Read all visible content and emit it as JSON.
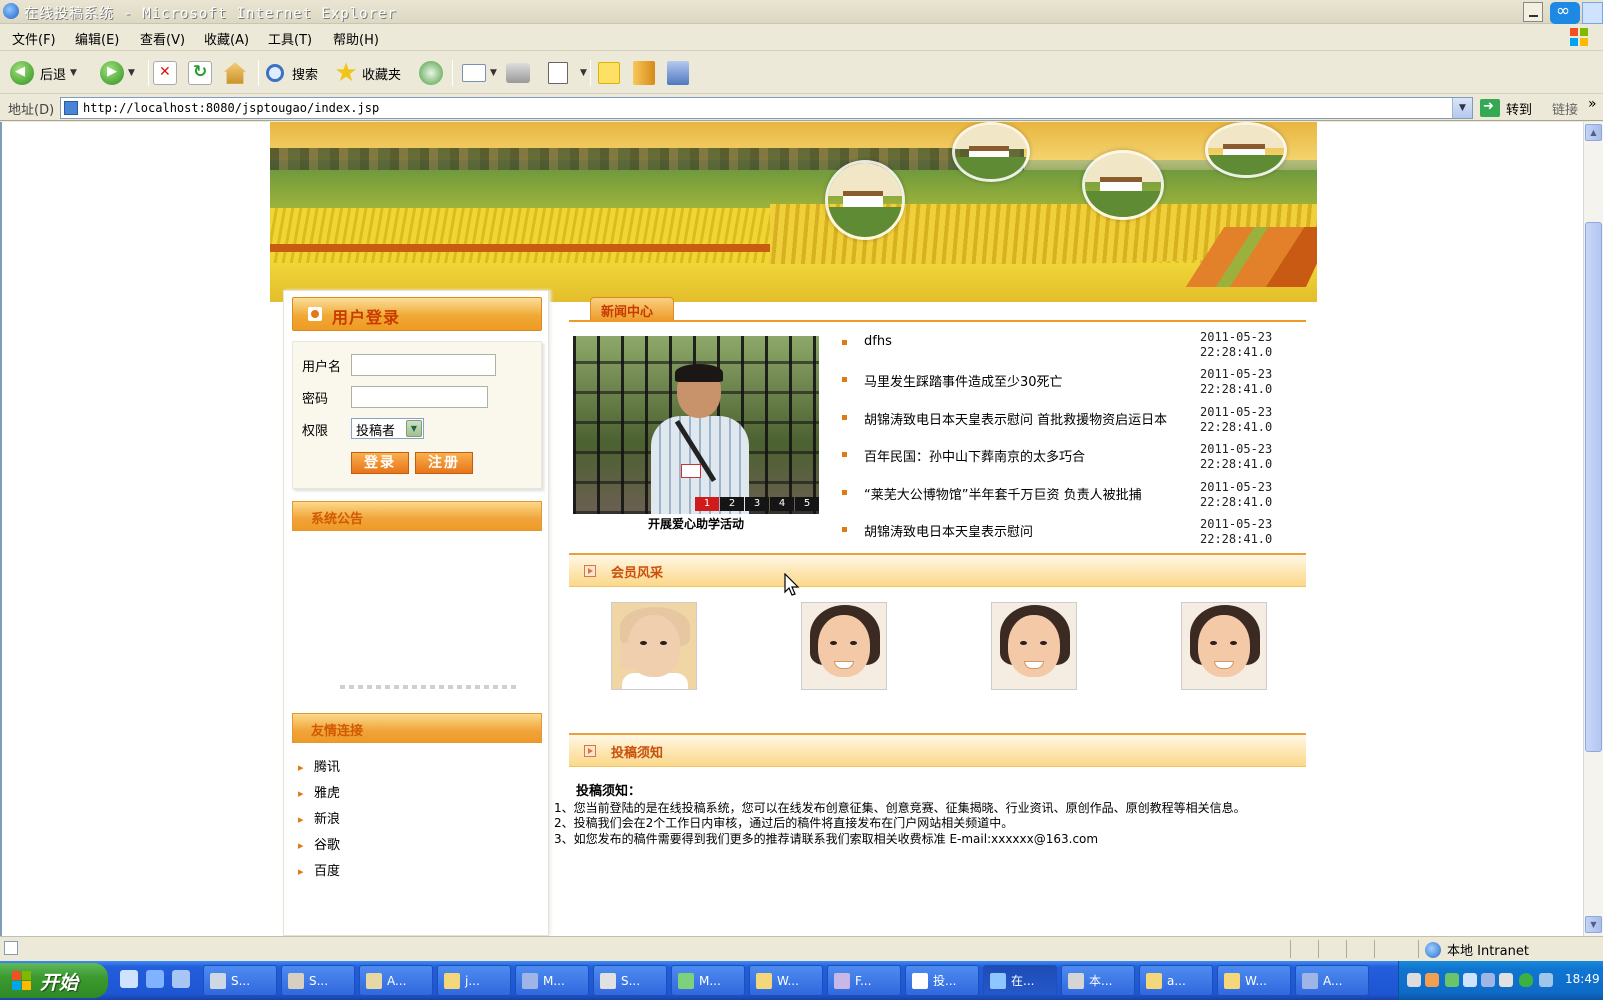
{
  "browser": {
    "title": "在线投稿系统 - Microsoft Internet Explorer",
    "menus": [
      "文件(F)",
      "编辑(E)",
      "查看(V)",
      "收藏(A)",
      "工具(T)",
      "帮助(H)"
    ],
    "toolbar": {
      "back": "后退",
      "search": "搜索",
      "favorites": "收藏夹"
    },
    "address_label": "地址(D)",
    "url": "http://localhost:8080/jsptougao/index.jsp",
    "go": "转到",
    "links": "链接",
    "more": "»",
    "status_zone": "本地 Intranet"
  },
  "login": {
    "title": "用户登录",
    "username_label": "用户名",
    "username_value": "",
    "password_label": "密码",
    "password_value": "",
    "role_label": "权限",
    "role_selected": "投稿者",
    "login_button": "登录",
    "register_button": "注册"
  },
  "announcement": {
    "title": "系统公告"
  },
  "friend_links": {
    "title": "友情连接",
    "items": [
      "腾讯",
      "雅虎",
      "新浪",
      "谷歌",
      "百度"
    ]
  },
  "news": {
    "tab": "新闻中心",
    "photo_caption": "开展爱心助学活动",
    "pager": [
      "1",
      "2",
      "3",
      "4",
      "5"
    ],
    "items": [
      {
        "title": "dfhs",
        "date": "2011-05-23",
        "time": "22:28:41.0"
      },
      {
        "title": "马里发生踩踏事件造成至少30死亡",
        "date": "2011-05-23",
        "time": "22:28:41.0"
      },
      {
        "title": "胡锦涛致电日本天皇表示慰问 首批救援物资启运日本",
        "date": "2011-05-23",
        "time": "22:28:41.0"
      },
      {
        "title": "百年民国：孙中山下葬南京的太多巧合",
        "date": "2011-05-23",
        "time": "22:28:41.0"
      },
      {
        "title": "“莱芜大公博物馆”半年套千万巨资 负责人被批捕",
        "date": "2011-05-23",
        "time": "22:28:41.0"
      },
      {
        "title": "胡锦涛致电日本天皇表示慰问",
        "date": "2011-05-23",
        "time": "22:28:41.0"
      }
    ]
  },
  "members": {
    "title": "会员风采"
  },
  "guidelines": {
    "title": "投稿须知",
    "heading": "投稿须知：",
    "lines": [
      "1、您当前登陆的是在线投稿系统，您可以在线发布创意征集、创意竞赛、征集揭晓、行业资讯、原创作品、原创教程等相关信息。",
      "2、投稿我们会在2个工作日内审核，通过后的稿件将直接发布在门户网站相关频道中。",
      "3、如您发布的稿件需要得到我们更多的推荐请联系我们索取相关收费标准 E-mail:xxxxxx@163.com"
    ]
  },
  "taskbar": {
    "start": "开始",
    "tasks": [
      "S...",
      "S...",
      "A...",
      "j...",
      "M...",
      "S...",
      "M...",
      "W...",
      "F...",
      "投...",
      "在...",
      "本...",
      "a...",
      "W...",
      "A..."
    ],
    "clock": "18:49"
  },
  "colors": {
    "accent": "#ee9a27",
    "heading_text": "#c83b00",
    "xp_blue": "#245edb"
  }
}
